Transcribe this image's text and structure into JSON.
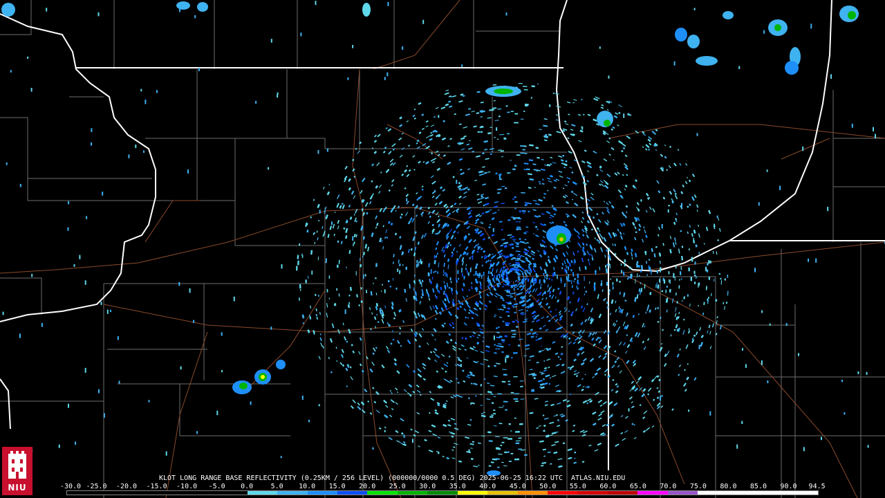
{
  "product": {
    "title": "KLOT LONG RANGE BASE REFLECTIVITY (0.25KM / 256 LEVEL) (000000/0000 0.5 DEG) 2025-06-25 16:22 UTC  ATLAS.NIU.EDU"
  },
  "logo": {
    "text": "NIU"
  },
  "color_scale": {
    "ticks": [
      "-30.0",
      "-25.0",
      "-20.0",
      "-15.0",
      "-10.0",
      "-5.0",
      "0.0",
      "5.0",
      "10.0",
      "15.0",
      "20.0",
      "25.0",
      "30.0",
      "35.0",
      "40.0",
      "45.0",
      "50.0",
      "55.0",
      "60.0",
      "65.0",
      "70.0",
      "75.0",
      "80.0",
      "85.0",
      "90.0",
      "94.5"
    ],
    "colors": [
      "#000000",
      "#000000",
      "#000000",
      "#000000",
      "#000000",
      "#000000",
      "#5fd8ea",
      "#3fb2f0",
      "#1e8ff8",
      "#0c4ef4",
      "#00e400",
      "#00b400",
      "#008c00",
      "#ffff00",
      "#e7c000",
      "#ff9000",
      "#ff0000",
      "#d60000",
      "#c00000",
      "#ff00ff",
      "#9955c9",
      "#ffffff",
      "#ffffff",
      "#ffffff",
      "#ffffff"
    ]
  },
  "map": {
    "background": "#000000",
    "state_border_color": "#ffffff",
    "county_line_color": "#777777",
    "road_color": "#a0522d",
    "radar_site_marker_color": "#000000"
  }
}
